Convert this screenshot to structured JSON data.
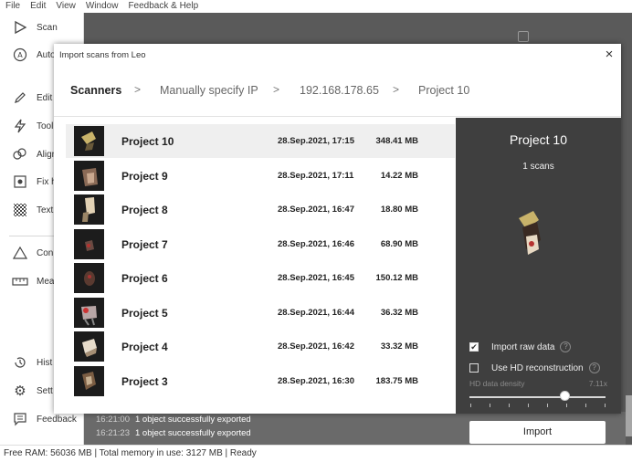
{
  "menu": [
    "File",
    "Edit",
    "View",
    "Window",
    "Feedback & Help"
  ],
  "sidebar": {
    "items": [
      {
        "label": "Scan",
        "icon": "play-icon"
      },
      {
        "label": "Auto",
        "icon": "auto-icon"
      },
      {
        "label": "Edit",
        "icon": "pencil-icon"
      },
      {
        "label": "Tool",
        "icon": "lightning-icon"
      },
      {
        "label": "Align",
        "icon": "align-icon"
      },
      {
        "label": "Fix h",
        "icon": "fix-icon"
      },
      {
        "label": "Text",
        "icon": "texture-icon"
      },
      {
        "label": "Con",
        "icon": "triangle-icon"
      },
      {
        "label": "Mea",
        "icon": "ruler-icon"
      },
      {
        "label": "Hist",
        "icon": "history-icon"
      },
      {
        "label": "Sett",
        "icon": "gear-icon"
      },
      {
        "label": "Feedback",
        "icon": "chat-icon"
      }
    ],
    "collapse": "«"
  },
  "log": [
    {
      "time": "16:21:00",
      "text": "1 object successfully exported"
    },
    {
      "time": "16:21:23",
      "text": "1 object successfully exported"
    }
  ],
  "status": "Free RAM: 56036 MB  |  Total memory in use: 3127 MB  |    Ready",
  "dialog": {
    "title": "Import scans from Leo",
    "close": "×",
    "breadcrumb": [
      "Scanners",
      "Manually specify IP",
      "192.168.178.65",
      "Project 10"
    ],
    "sep": ">",
    "projects": [
      {
        "name": "Project 10",
        "date": "28.Sep.2021, 17:15",
        "size": "348.41 MB"
      },
      {
        "name": "Project 9",
        "date": "28.Sep.2021, 17:11",
        "size": "14.22 MB"
      },
      {
        "name": "Project 8",
        "date": "28.Sep.2021, 16:47",
        "size": "18.80 MB"
      },
      {
        "name": "Project 7",
        "date": "28.Sep.2021, 16:46",
        "size": "68.90 MB"
      },
      {
        "name": "Project 6",
        "date": "28.Sep.2021, 16:45",
        "size": "150.12 MB"
      },
      {
        "name": "Project 5",
        "date": "28.Sep.2021, 16:44",
        "size": "36.32 MB"
      },
      {
        "name": "Project 4",
        "date": "28.Sep.2021, 16:42",
        "size": "33.32 MB"
      },
      {
        "name": "Project 3",
        "date": "28.Sep.2021, 16:30",
        "size": "183.75 MB"
      }
    ],
    "selected_index": 0,
    "panel": {
      "title": "Project 10",
      "subtitle": "1 scans",
      "import_raw_label": "Import raw data",
      "import_raw_checked": true,
      "hd_label": "Use HD reconstruction",
      "hd_checked": false,
      "density_label": "HD data density",
      "density_value": "7.11x",
      "import_button": "Import"
    }
  }
}
